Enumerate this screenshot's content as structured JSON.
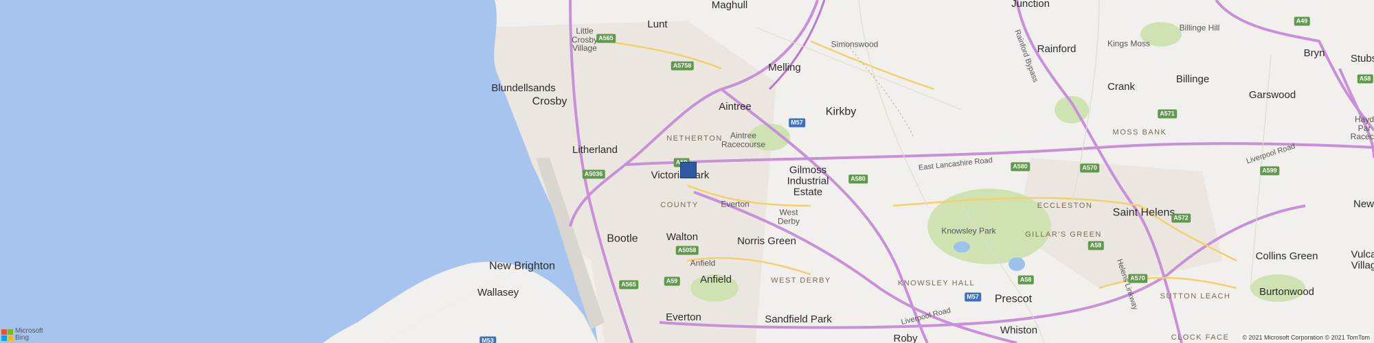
{
  "map": {
    "places": [
      {
        "key": "maghull",
        "text": "Maghull",
        "cls": "town"
      },
      {
        "key": "junction",
        "text": "Junction",
        "cls": "town"
      },
      {
        "key": "lunt",
        "text": "Lunt",
        "cls": "town"
      },
      {
        "key": "little_crosby",
        "text": "Little\nCrosby\nVillage",
        "cls": "small"
      },
      {
        "key": "simonswood",
        "text": "Simonswood",
        "cls": "small"
      },
      {
        "key": "rainford",
        "text": "Rainford",
        "cls": "town"
      },
      {
        "key": "kings_moss",
        "text": "Kings Moss",
        "cls": "small"
      },
      {
        "key": "billinge_hill",
        "text": "Billinge Hill",
        "cls": "small"
      },
      {
        "key": "bryn",
        "text": "Bryn",
        "cls": "town"
      },
      {
        "key": "stubs",
        "text": "Stubs",
        "cls": "town"
      },
      {
        "key": "melling",
        "text": "Melling",
        "cls": "town"
      },
      {
        "key": "blundellsands",
        "text": "Blundellsands",
        "cls": "town"
      },
      {
        "key": "crosby",
        "text": "Crosby",
        "cls": "town-big"
      },
      {
        "key": "crank",
        "text": "Crank",
        "cls": "town"
      },
      {
        "key": "billinge",
        "text": "Billinge",
        "cls": "town"
      },
      {
        "key": "garswood",
        "text": "Garswood",
        "cls": "town"
      },
      {
        "key": "aintree",
        "text": "Aintree",
        "cls": "town"
      },
      {
        "key": "kirkby",
        "text": "Kirkby",
        "cls": "town-big"
      },
      {
        "key": "haydock",
        "text": "Hayd\nPar\nRaceco",
        "cls": "small"
      },
      {
        "key": "moss_bank",
        "text": "MOSS BANK",
        "cls": "area"
      },
      {
        "key": "netherton",
        "text": "NETHERTON",
        "cls": "area"
      },
      {
        "key": "aintree_racecourse",
        "text": "Aintree\nRacecourse",
        "cls": "small"
      },
      {
        "key": "litherland",
        "text": "Litherland",
        "cls": "town"
      },
      {
        "key": "east_lancs_road",
        "text": "East Lancashire Road",
        "cls": "roadname"
      },
      {
        "key": "liverpool_road_ne",
        "text": "Liverpool Road",
        "cls": "roadname"
      },
      {
        "key": "victoria_park",
        "text": "Victoria Park",
        "cls": "town"
      },
      {
        "key": "gilmoss",
        "text": "Gilmoss\nIndustrial\nEstate",
        "cls": "town"
      },
      {
        "key": "county",
        "text": "COUNTY",
        "cls": "area"
      },
      {
        "key": "everton_n",
        "text": "Everton",
        "cls": "small"
      },
      {
        "key": "eccleston",
        "text": "ECCLESTON",
        "cls": "area"
      },
      {
        "key": "saint_helens",
        "text": "Saint Helens",
        "cls": "town-big"
      },
      {
        "key": "newton",
        "text": "New",
        "cls": "town"
      },
      {
        "key": "west_derby_small",
        "text": "West\nDerby",
        "cls": "small"
      },
      {
        "key": "knowsley_park",
        "text": "Knowsley Park",
        "cls": "small"
      },
      {
        "key": "gillars_green",
        "text": "GILLAR'S GREEN",
        "cls": "area"
      },
      {
        "key": "bootle",
        "text": "Bootle",
        "cls": "town-big"
      },
      {
        "key": "walton",
        "text": "Walton",
        "cls": "town"
      },
      {
        "key": "norris_green",
        "text": "Norris Green",
        "cls": "town"
      },
      {
        "key": "vulcan",
        "text": "Vulca\nVillag",
        "cls": "town"
      },
      {
        "key": "anfield_small",
        "text": "Anfield",
        "cls": "small"
      },
      {
        "key": "collins_green",
        "text": "Collins Green",
        "cls": "town"
      },
      {
        "key": "new_brighton",
        "text": "New Brighton",
        "cls": "town-big"
      },
      {
        "key": "anfield",
        "text": "Anfield",
        "cls": "town"
      },
      {
        "key": "west_derby",
        "text": "WEST DERBY",
        "cls": "area"
      },
      {
        "key": "knowsley_hall",
        "text": "KNOWSLEY HALL",
        "cls": "area"
      },
      {
        "key": "sutton_leach",
        "text": "SUTTON LEACH",
        "cls": "area"
      },
      {
        "key": "burtonwood",
        "text": "Burtonwood",
        "cls": "town"
      },
      {
        "key": "wallasey",
        "text": "Wallasey",
        "cls": "town"
      },
      {
        "key": "everton_s",
        "text": "Everton",
        "cls": "town"
      },
      {
        "key": "sandfield_park",
        "text": "Sandfield Park",
        "cls": "town"
      },
      {
        "key": "liverpool_road_s",
        "text": "Liverpool Road",
        "cls": "roadname"
      },
      {
        "key": "prescot",
        "text": "Prescot",
        "cls": "town-big"
      },
      {
        "key": "roby",
        "text": "Roby",
        "cls": "town"
      },
      {
        "key": "whiston",
        "text": "Whiston",
        "cls": "town"
      },
      {
        "key": "clock_face",
        "text": "CLOCK FACE",
        "cls": "area"
      },
      {
        "key": "rainford_bypass",
        "text": "Rainford Bypass",
        "cls": "roadname"
      },
      {
        "key": "link_road",
        "text": "Helens Linkway",
        "cls": "roadname"
      }
    ],
    "shields": [
      {
        "key": "a565_n",
        "text": "A565",
        "type": "a"
      },
      {
        "key": "a5758",
        "text": "A5758",
        "type": "a"
      },
      {
        "key": "a49",
        "text": "A49",
        "type": "a"
      },
      {
        "key": "a58_ne",
        "text": "A58",
        "type": "a"
      },
      {
        "key": "m57_n",
        "text": "M57",
        "type": "motorway"
      },
      {
        "key": "a571",
        "text": "A571",
        "type": "a"
      },
      {
        "key": "a59",
        "text": "A59",
        "type": "a"
      },
      {
        "key": "a5036",
        "text": "A5036",
        "type": "a"
      },
      {
        "key": "a580_w",
        "text": "A580",
        "type": "a"
      },
      {
        "key": "a580_e",
        "text": "A580",
        "type": "a"
      },
      {
        "key": "a570_n",
        "text": "A570",
        "type": "a"
      },
      {
        "key": "a599",
        "text": "A599",
        "type": "a"
      },
      {
        "key": "a572",
        "text": "A572",
        "type": "a"
      },
      {
        "key": "a5058",
        "text": "A5058",
        "type": "a"
      },
      {
        "key": "a58_m",
        "text": "A58",
        "type": "a"
      },
      {
        "key": "a565_s",
        "text": "A565",
        "type": "a"
      },
      {
        "key": "a59_s",
        "text": "A59",
        "type": "a"
      },
      {
        "key": "a58_s",
        "text": "A58",
        "type": "a"
      },
      {
        "key": "a570_s",
        "text": "A570",
        "type": "a"
      },
      {
        "key": "m57_s",
        "text": "M57",
        "type": "motorway"
      },
      {
        "key": "m53",
        "text": "M53",
        "type": "motorway"
      }
    ],
    "pin_label": "Victoria Park",
    "logo_text": "Microsoft\nBing",
    "copyright": "© 2021 Microsoft Corporation © 2021 TomTom",
    "colors": {
      "sea": "#a7c4ee",
      "land": "#f2f0ec",
      "park": "#cfe3b2",
      "road_major": "#c790d8",
      "road_a": "#f2d06b",
      "pin": "#2d5a9e"
    }
  }
}
